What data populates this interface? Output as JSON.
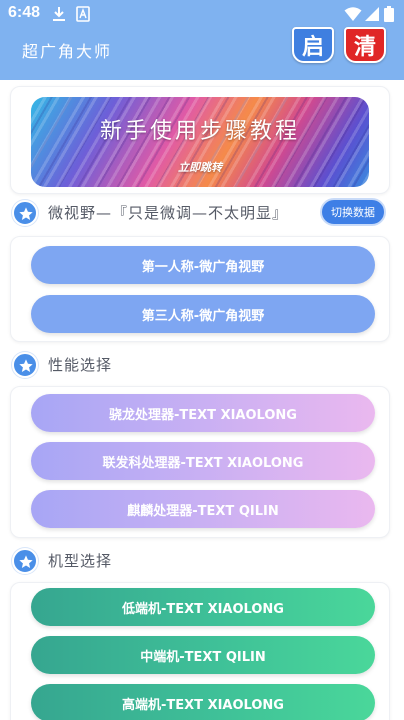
{
  "status_bar": {
    "time": "6:48",
    "icons": [
      "download-icon",
      "font-a-icon",
      "wifi-icon",
      "signal-icon",
      "battery-icon"
    ]
  },
  "app_bar": {
    "title": "超广角大师",
    "start_badge": "启",
    "clean_badge": "清"
  },
  "banner": {
    "title": "新手使用步骤教程",
    "subtitle": "立即跳转"
  },
  "sections": {
    "view": {
      "label": "微视野—『只是微调—不太明显』",
      "switch_button": "切换数据",
      "options": [
        "第一人称-微广角视野",
        "第三人称-微广角视野"
      ]
    },
    "performance": {
      "label": "性能选择",
      "options": [
        "骁龙处理器-TEXT XIAOLONG",
        "联发科处理器-TEXT XIAOLONG",
        "麒麟处理器-TEXT QILIN"
      ]
    },
    "model": {
      "label": "机型选择",
      "options": [
        "低端机-TEXT XIAOLONG",
        "中端机-TEXT QILIN",
        "高端机-TEXT XIAOLONG"
      ]
    }
  },
  "colors": {
    "header": "#7fb2f0",
    "accent_blue": "#3e7fe6",
    "pill_blue": "#7ea6f2",
    "clean_red": "#e02626"
  }
}
